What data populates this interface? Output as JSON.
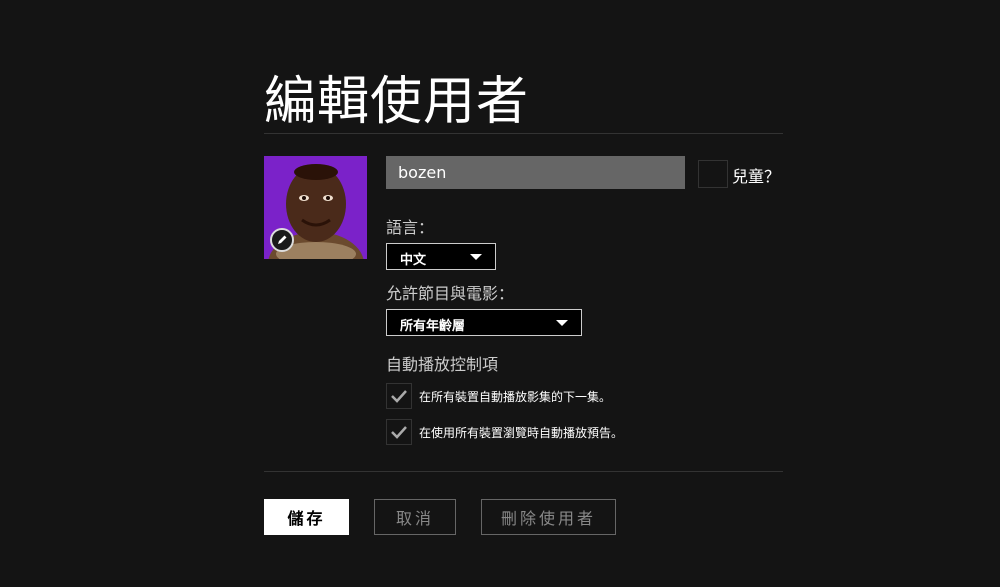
{
  "header": {
    "title": "編輯使用者"
  },
  "profile": {
    "name_value": "bozen",
    "avatar_icon": "profile-avatar",
    "edit_icon": "pencil-icon",
    "kids_label": "兒童？"
  },
  "language": {
    "label": "語言：",
    "selected": "中文"
  },
  "maturity": {
    "label": "允許節目與電影：",
    "selected": "所有年齡層"
  },
  "autoplay": {
    "heading": "自動播放控制項",
    "options": [
      {
        "label": "在所有裝置自動播放影集的下一集。",
        "checked": true
      },
      {
        "label": "在使用所有裝置瀏覽時自動播放預告。",
        "checked": true
      }
    ]
  },
  "actions": {
    "save_label": "儲存",
    "cancel_label": "取消",
    "delete_label": "刪除使用者"
  },
  "colors": {
    "background": "#141414",
    "avatar_bg": "#8a2be2"
  }
}
